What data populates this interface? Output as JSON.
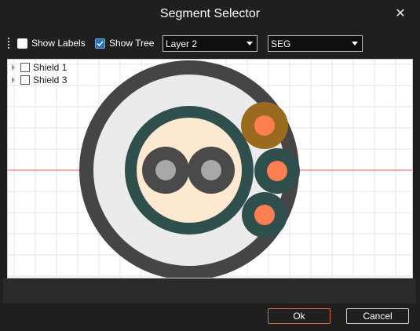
{
  "window": {
    "title": "Segment Selector",
    "close_glyph": "✕"
  },
  "toolbar": {
    "show_labels": {
      "label": "Show Labels",
      "checked": false
    },
    "show_tree": {
      "label": "Show Tree",
      "checked": true
    },
    "layer_select": {
      "value": "Layer 2"
    },
    "segment_select": {
      "value": "SEG"
    }
  },
  "tree": {
    "items": [
      {
        "label": "Shield 1",
        "checked": false
      },
      {
        "label": "Shield 3",
        "checked": false
      }
    ]
  },
  "buttons": {
    "ok": "Ok",
    "cancel": "Cancel"
  },
  "colors": {
    "background": "#1f1f1f",
    "outer_jacket": "#454545",
    "fill": "#ebebeb",
    "shield": "#2f4f4c",
    "core_fill": "#fde8d0",
    "conductor_ring": "#4a4a4a",
    "conductor_core": "#a8a8a8",
    "orange_core": "#ff7f50",
    "brown_ring": "#9a6a1e",
    "axis_line": "#e05a5a",
    "primary_button_border": "#e06a3a"
  }
}
